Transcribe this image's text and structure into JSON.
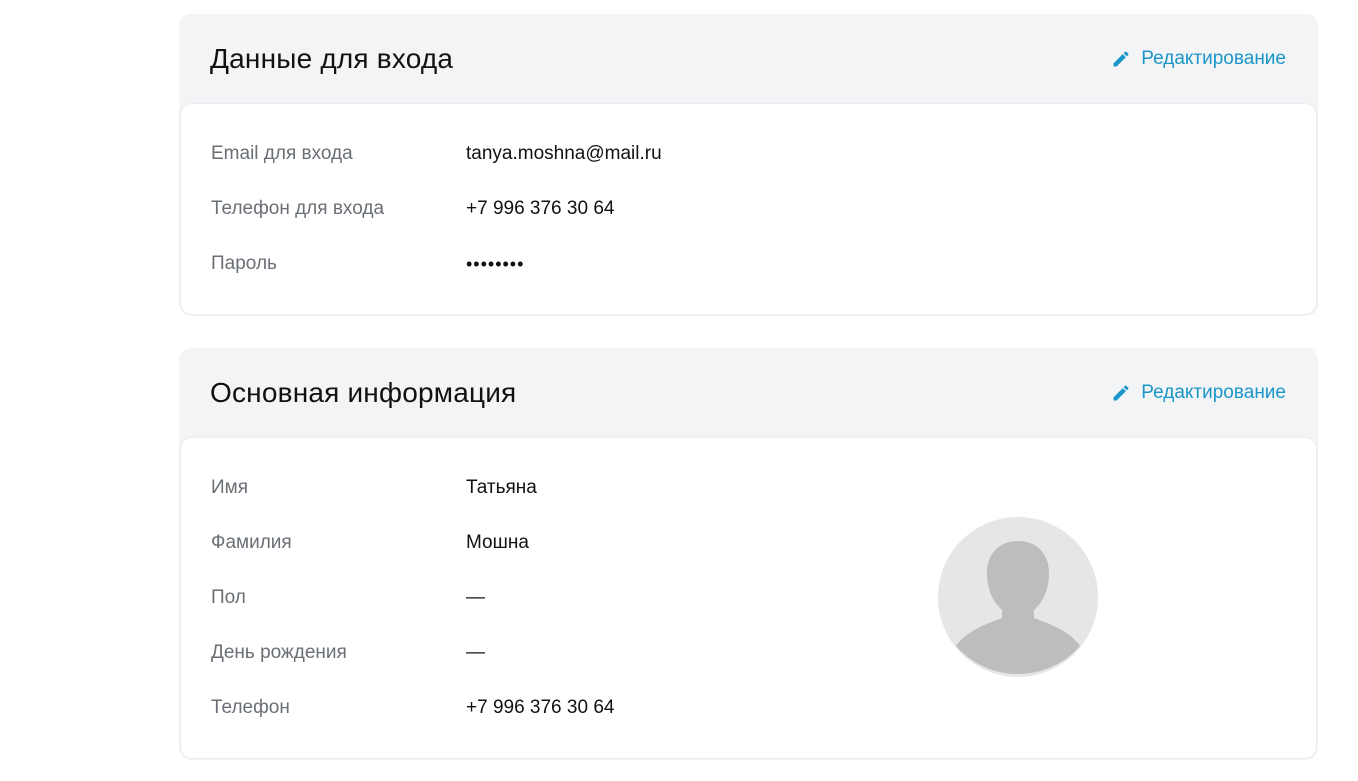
{
  "login_section": {
    "title": "Данные для входа",
    "edit_label": "Редактирование",
    "fields": [
      {
        "label": "Email для входа",
        "value": "tanya.moshna@mail.ru"
      },
      {
        "label": "Телефон для входа",
        "value": "+7 996 376 30 64"
      },
      {
        "label": "Пароль",
        "value": "••••••••"
      }
    ]
  },
  "main_section": {
    "title": "Основная информация",
    "edit_label": "Редактирование",
    "fields": [
      {
        "label": "Имя",
        "value": "Татьяна"
      },
      {
        "label": "Фамилия",
        "value": "Мошна"
      },
      {
        "label": "Пол",
        "value": "—"
      },
      {
        "label": "День рождения",
        "value": "—"
      },
      {
        "label": "Телефон",
        "value": "+7 996 376 30 64"
      }
    ],
    "avatar_icon": "user-silhouette-icon"
  },
  "colors": {
    "accent": "#1b96c8",
    "card_header_bg": "#f3f4f6",
    "label_text": "#6a6f76",
    "avatar_bg": "#e6e6e6",
    "avatar_figure": "#bdbdbd"
  }
}
